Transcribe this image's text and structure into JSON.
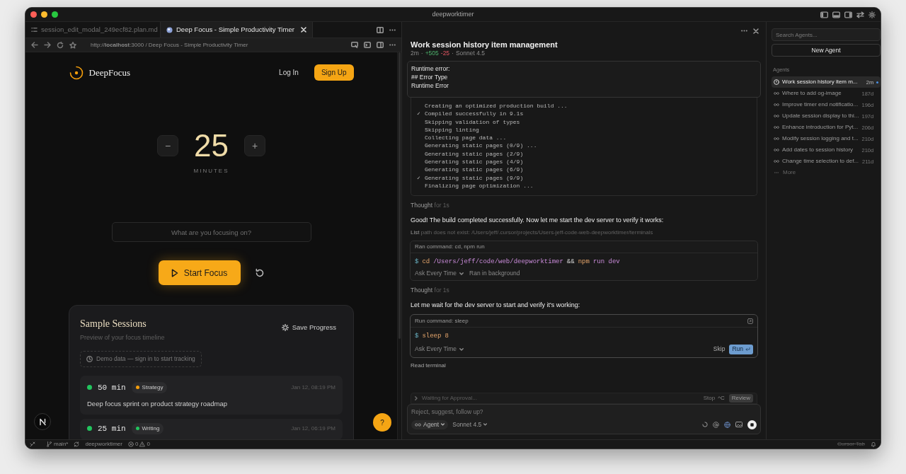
{
  "window": {
    "title": "deepworktimer"
  },
  "browser": {
    "tabs": [
      {
        "label": "session_edit_modal_249ecf82.plan.md",
        "kind": "file",
        "selected": false
      },
      {
        "label": "Deep Focus - Simple Productivity Timer",
        "kind": "web",
        "selected": true
      }
    ],
    "address": "http://**localhost**:3000 / Deep Focus - Simple Productivity Timer"
  },
  "app": {
    "brand": "DeepFocus",
    "login": "Log In",
    "signup": "Sign Up",
    "timer": {
      "minus": "−",
      "value": "25",
      "plus": "+",
      "unit": "MINUTES"
    },
    "focus_field": {
      "placeholder": "What are you focusing on?"
    },
    "start_button": "Start Focus",
    "sessions_card": {
      "title": "Sample Sessions",
      "subtitle": "Preview of your focus timeline",
      "save": "Save Progress",
      "notice": "Demo data — sign in to start tracking",
      "sessions": [
        {
          "duration": "50 min",
          "color": "#22c55e",
          "tag": {
            "label": "Strategy",
            "color": "#f59e0b"
          },
          "date": "Jan 12, 08:19 PM",
          "description": "Deep focus sprint on product strategy roadmap"
        },
        {
          "duration": "25 min",
          "color": "#22c55e",
          "tag": {
            "label": "Writing",
            "color": "#22c55e"
          },
          "date": "Jan 12, 06:19 PM"
        }
      ]
    },
    "help_button": "?"
  },
  "agent_chat": {
    "title": "Work session history item management",
    "meta": [
      {
        "kind": "plain",
        "text": "2m"
      },
      {
        "kind": "plain",
        "text": "·"
      },
      {
        "kind": "added",
        "text": "+505"
      },
      {
        "kind": "removed",
        "text": "-25"
      },
      {
        "kind": "plain",
        "text": "·"
      },
      {
        "kind": "plain",
        "text": "Sonnet 4.5"
      }
    ],
    "messages": [
      {
        "kind": "error",
        "lines": [
          "Runtime error:",
          "## Error Type",
          "Runtime Error"
        ]
      },
      {
        "kind": "terminal",
        "lines": [
          {
            "text": "Creating an optimized production build ..."
          },
          {
            "mark": "✓",
            "text": "Compiled successfully in 9.1s"
          },
          {
            "text": "Skipping validation of types"
          },
          {
            "text": "Skipping linting"
          },
          {
            "text": "Collecting page data ..."
          },
          {
            "text": "Generating static pages (0/9) ..."
          },
          {
            "text": "Generating static pages (2/9)"
          },
          {
            "text": "Generating static pages (4/9)"
          },
          {
            "text": "Generating static pages (6/9)"
          },
          {
            "mark": "✓",
            "text": "Generating static pages (9/9)"
          },
          {
            "text": "Finalizing page optimization ..."
          }
        ]
      },
      {
        "kind": "thought",
        "label": "Thought",
        "duration": "for 1s"
      },
      {
        "kind": "text",
        "text": "Good! The build completed successfully. Now let me start the dev server to verify it works:"
      },
      {
        "kind": "tool",
        "label": "List",
        "detail": "path does not exist: /Users/jeff/.cursor/projects/Users-jeff-code-web-deepworktimer/terminals"
      },
      {
        "kind": "ran_command",
        "header": "Ran command: cd, npm run",
        "tokens": [
          {
            "kind": "prompt",
            "text": "$"
          },
          {
            "kind": "command",
            "text": "cd"
          },
          {
            "kind": "argument",
            "text": "/Users/jeff/code/web/deepworktimer"
          },
          {
            "kind": "operator",
            "text": "&&"
          },
          {
            "kind": "command",
            "text": "npm"
          },
          {
            "kind": "argument",
            "text": "run dev"
          }
        ],
        "approval": "Ask Every Time",
        "status": "Ran in background"
      },
      {
        "kind": "thought",
        "label": "Thought",
        "duration": "for 1s"
      },
      {
        "kind": "text",
        "text": "Let me wait for the dev server to start and verify it's working:"
      },
      {
        "kind": "pending_command",
        "header": "Run command: sleep",
        "tokens": [
          {
            "kind": "prompt",
            "text": "$"
          },
          {
            "kind": "command",
            "text": "sleep"
          },
          {
            "kind": "number",
            "text": "8"
          }
        ],
        "approval": "Ask Every Time",
        "skip": "Skip",
        "run": "Run"
      },
      {
        "kind": "plain",
        "text": "Read terminal"
      }
    ]
  },
  "composer": {
    "status": "Waiting for Approval...",
    "stop": "Stop",
    "stop_shortcut": "^C",
    "review": "Review",
    "placeholder": "Reject, suggest, follow up?",
    "mode": "Agent",
    "model": "Sonnet 4.5"
  },
  "sidebar": {
    "search_placeholder": "Search Agents...",
    "new_button": "New Agent",
    "section": "Agents",
    "items": [
      {
        "title": "Work session history item m...",
        "time": "2m",
        "kind": "running",
        "selected": true,
        "unread": true
      },
      {
        "title": "Where to add og-image",
        "time": "187d",
        "kind": "idle",
        "selected": false,
        "unread": false
      },
      {
        "title": "Improve timer end notificatio...",
        "time": "196d",
        "kind": "idle",
        "selected": false,
        "unread": false
      },
      {
        "title": "Update session display to thi...",
        "time": "197d",
        "kind": "idle",
        "selected": false,
        "unread": false
      },
      {
        "title": "Enhance introduction for Pyt...",
        "time": "206d",
        "kind": "idle",
        "selected": false,
        "unread": false
      },
      {
        "title": "Modify session logging and t...",
        "time": "210d",
        "kind": "idle",
        "selected": false,
        "unread": false
      },
      {
        "title": "Add dates to session history",
        "time": "210d",
        "kind": "idle",
        "selected": false,
        "unread": false
      },
      {
        "title": "Change time selection to def...",
        "time": "211d",
        "kind": "idle",
        "selected": false,
        "unread": false
      }
    ],
    "more": "More"
  },
  "status_bar": {
    "branch": "main*",
    "project": "deepworktimer",
    "errors": "0",
    "warnings": "0",
    "cursor_tab": {
      "label": "Cursor Tab",
      "disabled": true
    }
  }
}
